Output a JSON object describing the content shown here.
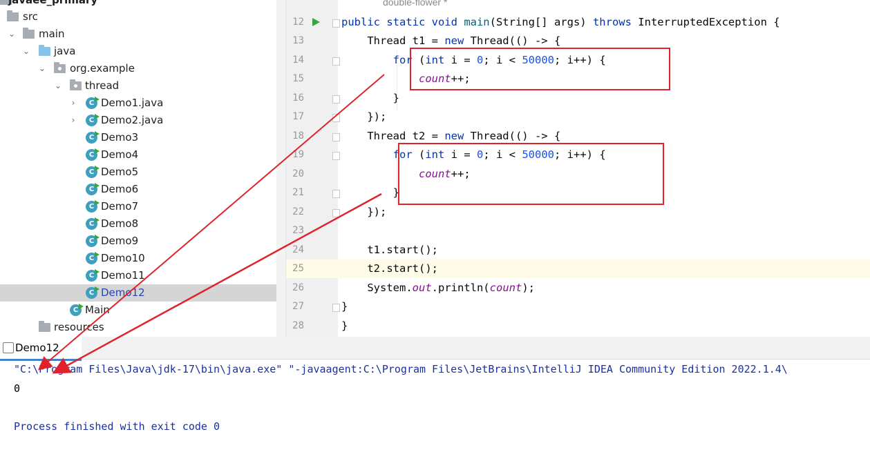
{
  "project_tree": {
    "items": [
      {
        "label": "javaee_primary",
        "icon": "folder-icon"
      },
      {
        "label": "src",
        "icon": "folder-icon"
      },
      {
        "label": "main",
        "icon": "folder-icon"
      },
      {
        "label": "java",
        "icon": "source-folder-icon"
      },
      {
        "label": "org.example",
        "icon": "package-icon"
      },
      {
        "label": "thread",
        "icon": "package-icon"
      },
      {
        "label": "Demo1.java",
        "icon": "java-class-icon"
      },
      {
        "label": "Demo2.java",
        "icon": "java-class-icon"
      },
      {
        "label": "Demo3",
        "icon": "java-class-icon"
      },
      {
        "label": "Demo4",
        "icon": "java-class-icon"
      },
      {
        "label": "Demo5",
        "icon": "java-class-icon"
      },
      {
        "label": "Demo6",
        "icon": "java-class-icon"
      },
      {
        "label": "Demo7",
        "icon": "java-class-icon"
      },
      {
        "label": "Demo8",
        "icon": "java-class-icon"
      },
      {
        "label": "Demo9",
        "icon": "java-class-icon"
      },
      {
        "label": "Demo10",
        "icon": "java-class-icon"
      },
      {
        "label": "Demo11",
        "icon": "java-class-icon"
      },
      {
        "label": "Demo12",
        "icon": "java-class-icon",
        "selected": true
      },
      {
        "label": "Main",
        "icon": "java-class-icon"
      },
      {
        "label": "resources",
        "icon": "resources-folder-icon"
      }
    ]
  },
  "editor": {
    "breadcrumb": "double-flower *",
    "lines": [
      {
        "num": "12"
      },
      {
        "num": "13"
      },
      {
        "num": "14"
      },
      {
        "num": "15"
      },
      {
        "num": "16"
      },
      {
        "num": "17"
      },
      {
        "num": "18"
      },
      {
        "num": "19"
      },
      {
        "num": "20"
      },
      {
        "num": "21"
      },
      {
        "num": "22"
      },
      {
        "num": "23"
      },
      {
        "num": "24"
      },
      {
        "num": "25"
      },
      {
        "num": "26"
      },
      {
        "num": "27"
      },
      {
        "num": "28"
      }
    ],
    "code": {
      "l12_a": "public static void ",
      "l12_b": "main",
      "l12_c": "(String[] args) ",
      "l12_d": "throws",
      "l12_e": " InterruptedException {",
      "l13_a": "    Thread t1 = ",
      "l13_b": "new",
      "l13_c": " Thread(() -> {",
      "l14_a": "        ",
      "l14_b": "for",
      "l14_c": " (",
      "l14_d": "int",
      "l14_e": " i = ",
      "l14_f": "0",
      "l14_g": "; i < ",
      "l14_h": "50000",
      "l14_i": "; i++) {",
      "l15_a": "            ",
      "l15_b": "count",
      "l15_c": "++;",
      "l16": "        }",
      "l17": "    });",
      "l18_a": "    Thread t2 = ",
      "l18_b": "new",
      "l18_c": " Thread(() -> {",
      "l19_a": "        ",
      "l19_b": "for",
      "l19_c": " (",
      "l19_d": "int",
      "l19_e": " i = ",
      "l19_f": "0",
      "l19_g": "; i < ",
      "l19_h": "50000",
      "l19_i": "; i++) {",
      "l20_a": "            ",
      "l20_b": "count",
      "l20_c": "++;",
      "l21": "        }",
      "l22": "    });",
      "l23": "",
      "l24": "    t1.start();",
      "l25": "    t2.start();",
      "l26_a": "    System.",
      "l26_b": "out",
      "l26_c": ".println(",
      "l26_d": "count",
      "l26_e": ");",
      "l27": "}",
      "l28": "}"
    }
  },
  "run_panel": {
    "tab_label": "Demo12",
    "console": [
      "\"C:\\Program Files\\Java\\jdk-17\\bin\\java.exe\" \"-javaagent:C:\\Program Files\\JetBrains\\IntelliJ IDEA Community Edition 2022.1.4\\",
      "0",
      "",
      "Process finished with exit code 0"
    ],
    "command_color": "#1a2fa0",
    "output_color": "#000000"
  },
  "annotations": {
    "box_color": "#e0232b",
    "arrow_color": "#e0232b"
  }
}
